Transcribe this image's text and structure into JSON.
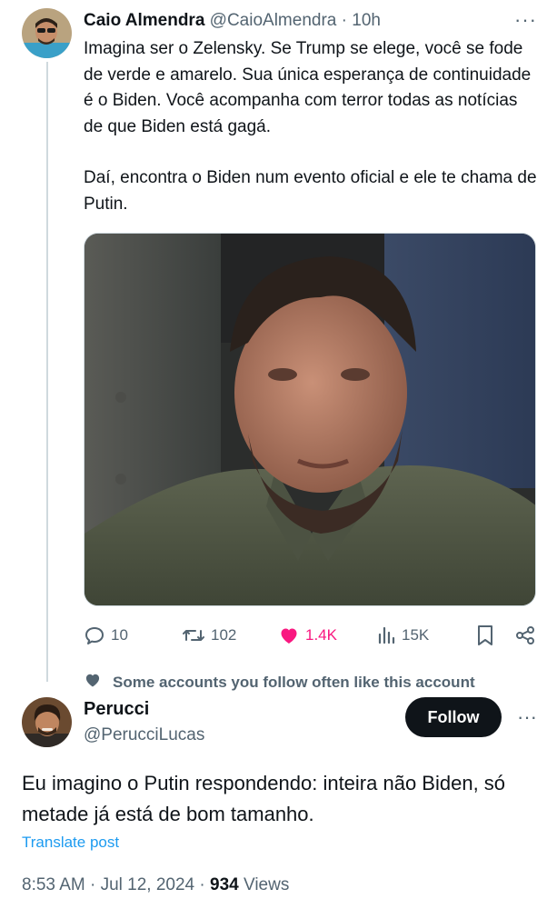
{
  "original_tweet": {
    "author_name": "Caio Almendra",
    "author_handle": "@CaioAlmendra",
    "separator": "·",
    "time": "10h",
    "more_label": "···",
    "text_paragraph_1": "Imagina ser o Zelensky. Se Trump se elege, você se fode de verde e amarelo. Sua única esperança de continuidade é o Biden. Você acompanha com terror todas as notícias de que Biden está gagá.",
    "text_paragraph_2": "Daí, encontra o Biden num evento oficial e ele te chama de Putin.",
    "actions": {
      "replies": "10",
      "retweets": "102",
      "likes": "1.4K",
      "views": "15K"
    },
    "icons": [
      "reply-icon",
      "retweet-icon",
      "heart-icon",
      "views-icon",
      "bookmark-icon",
      "share-icon"
    ]
  },
  "context_label": "Some accounts you follow often like this account",
  "reply_tweet": {
    "author_name": "Perucci",
    "author_handle": "@PerucciLucas",
    "follow_label": "Follow",
    "more_label": "···",
    "text": "Eu imagino o Putin respondendo: inteira não Biden, só metade já está de bom tamanho.",
    "translate_label": "Translate post",
    "timestamp": "8:53 AM · Jul 12, 2024",
    "meta_separator": "·",
    "views_count": "934",
    "views_label": "Views"
  },
  "colors": {
    "text": "#0f1419",
    "secondary": "#536471",
    "like": "#f91880",
    "link": "#1d9bf0",
    "follow_bg": "#0f1419"
  }
}
